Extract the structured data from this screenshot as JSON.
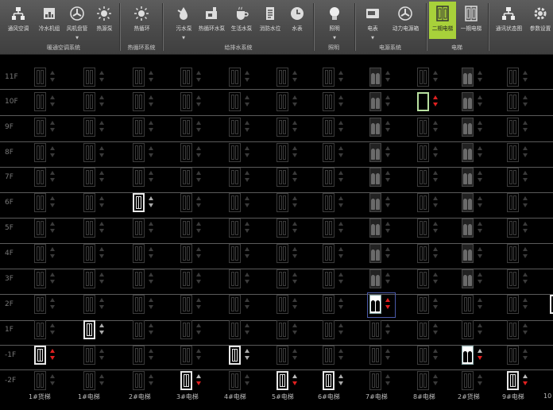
{
  "toolbar": {
    "buttons": [
      {
        "label": "通风空调",
        "icon": "network-icon"
      },
      {
        "label": "冷水机组",
        "icon": "chiller-icon"
      },
      {
        "label": "风机盘管",
        "icon": "fan-icon"
      },
      {
        "label": "热源泵",
        "icon": "sun-icon"
      },
      {
        "label": "热循环",
        "icon": "sun-icon"
      },
      {
        "label": "污水泵",
        "icon": "wastewater-pump-icon"
      },
      {
        "label": "热循环水泵",
        "icon": "pump-icon"
      },
      {
        "label": "生活水泵",
        "icon": "cup-icon"
      },
      {
        "label": "消防水位",
        "icon": "gauge-icon"
      },
      {
        "label": "水表",
        "icon": "clock-icon"
      },
      {
        "label": "照明",
        "icon": "bulb-icon"
      },
      {
        "label": "电表",
        "icon": "meter-icon"
      },
      {
        "label": "动力电源箱",
        "icon": "power-box-icon"
      },
      {
        "label": "二期电梯",
        "icon": "elevator-icon"
      },
      {
        "label": "一期电梯",
        "icon": "elevator-icon"
      },
      {
        "label": "通讯状态图",
        "icon": "network-icon"
      },
      {
        "label": "参数设置",
        "icon": "gear-icon"
      }
    ],
    "groups": [
      "暖通空调系统",
      "热循环系统",
      "给排水系统",
      "照明",
      "电源系统",
      "电梯"
    ]
  },
  "floors": [
    "11F",
    "10F",
    "9F",
    "8F",
    "7F",
    "6F",
    "5F",
    "4F",
    "3F",
    "2F",
    "1F",
    "-1F",
    "-2F"
  ],
  "elevators": [
    "1#货梯",
    "1#电梯",
    "2#电梯",
    "3#电梯",
    "4#电梯",
    "5#电梯",
    "6#电梯",
    "7#电梯",
    "8#电梯",
    "2#货梯",
    "9#电梯",
    "10"
  ],
  "accent": "#a8d13a"
}
